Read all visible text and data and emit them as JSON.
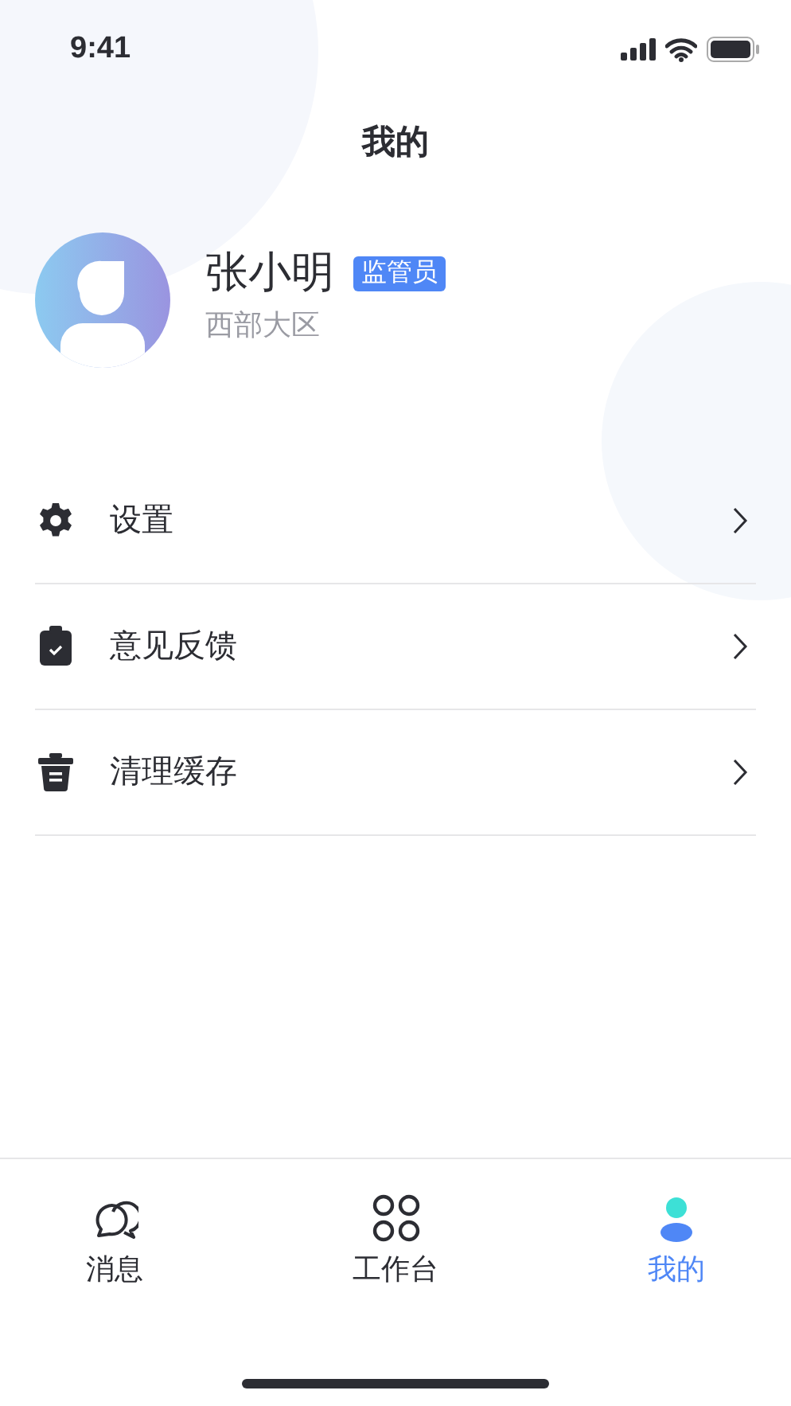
{
  "status_bar": {
    "time": "9:41"
  },
  "title": "我的",
  "profile": {
    "name": "张小明",
    "role": "监管员",
    "region": "西部大区"
  },
  "menu": [
    {
      "label": "设置"
    },
    {
      "label": "意见反馈"
    },
    {
      "label": "清理缓存"
    }
  ],
  "tabs": [
    {
      "label": "消息",
      "selected": false
    },
    {
      "label": "工作台",
      "selected": false
    },
    {
      "label": "我的",
      "selected": true
    }
  ]
}
